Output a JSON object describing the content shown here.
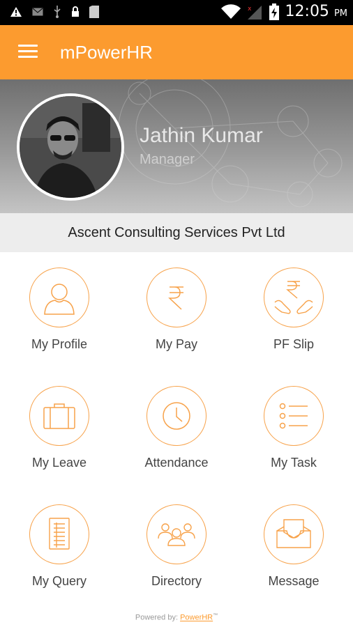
{
  "status_bar": {
    "time": "12:05",
    "ampm": "PM"
  },
  "app_bar": {
    "title": "mPowerHR"
  },
  "profile": {
    "name": "Jathin Kumar",
    "role": "Manager"
  },
  "company": {
    "name": "Ascent Consulting Services Pvt Ltd"
  },
  "menu": {
    "items": [
      {
        "label": "My Profile",
        "icon": "person-icon"
      },
      {
        "label": "My Pay",
        "icon": "rupee-icon"
      },
      {
        "label": "PF Slip",
        "icon": "rupee-hands-icon"
      },
      {
        "label": "My Leave",
        "icon": "suitcase-icon"
      },
      {
        "label": "Attendance",
        "icon": "clock-icon"
      },
      {
        "label": "My Task",
        "icon": "task-list-icon"
      },
      {
        "label": "My Query",
        "icon": "document-icon"
      },
      {
        "label": "Directory",
        "icon": "people-group-icon"
      },
      {
        "label": "Message",
        "icon": "inbox-tray-icon"
      }
    ]
  },
  "footer": {
    "prefix": "Powered by: ",
    "brand": "PowerHR",
    "tm": "™"
  },
  "colors": {
    "accent": "#fc9b2f",
    "icon_stroke": "#f7a24a"
  }
}
